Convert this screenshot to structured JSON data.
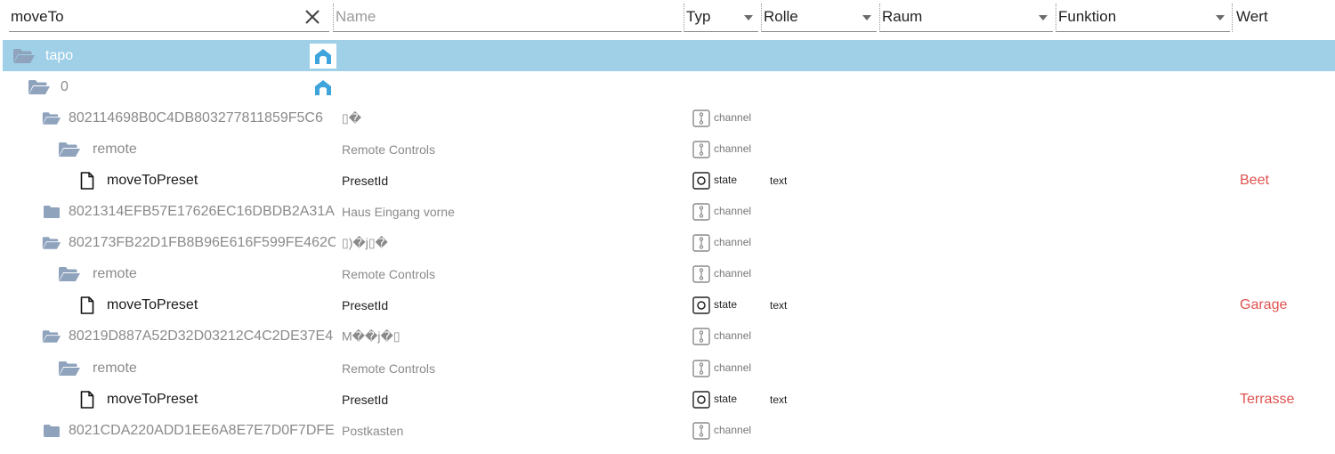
{
  "filters": {
    "id_value": "moveTo",
    "name_placeholder": "Name",
    "typ_label": "Typ",
    "rolle_label": "Rolle",
    "raum_label": "Raum",
    "funktion_label": "Funktion",
    "wert_label": "Wert"
  },
  "tree": {
    "root": {
      "label": "tapo"
    },
    "instance": {
      "label": "0"
    },
    "devices": [
      {
        "id": "802114698B0C4DB803277811859F5C6",
        "name": "▯�",
        "type": "channel",
        "children": [
          {
            "id": "remote",
            "name": "Remote Controls",
            "type": "channel"
          },
          {
            "id": "moveToPreset",
            "name": "PresetId",
            "type": "state",
            "role": "text",
            "value": "Beet"
          }
        ]
      },
      {
        "id": "8021314EFB57E17626EC16DBDB2A31A",
        "name": "Haus Eingang vorne",
        "type": "channel"
      },
      {
        "id": "802173FB22D1FB8B96E616F599FE462C",
        "name": "▯)�j▯�",
        "type": "channel",
        "children": [
          {
            "id": "remote",
            "name": "Remote Controls",
            "type": "channel"
          },
          {
            "id": "moveToPreset",
            "name": "PresetId",
            "type": "state",
            "role": "text",
            "value": "Garage"
          }
        ]
      },
      {
        "id": "80219D887A52D32D03212C4C2DE37E4",
        "name": "M��j�▯",
        "type": "channel",
        "children": [
          {
            "id": "remote",
            "name": "Remote Controls",
            "type": "channel"
          },
          {
            "id": "moveToPreset",
            "name": "PresetId",
            "type": "state",
            "role": "text",
            "value": "Terrasse"
          }
        ]
      },
      {
        "id": "8021CDA220ADD1EE6A8E7E7D0F7DFE",
        "name": "Postkasten",
        "type": "channel"
      }
    ]
  },
  "colors": {
    "selected_row": "#9fd0e8",
    "folder_icon": "#8fa3bd",
    "value_text": "#e0524f",
    "home_icon": "#3fa3dc"
  },
  "icons": {
    "clear": "close-icon",
    "folder_open": "folder-open-icon",
    "folder_closed": "folder-icon",
    "file": "file-icon",
    "channel": "channel-icon",
    "state": "state-icon",
    "home": "home-icon"
  }
}
